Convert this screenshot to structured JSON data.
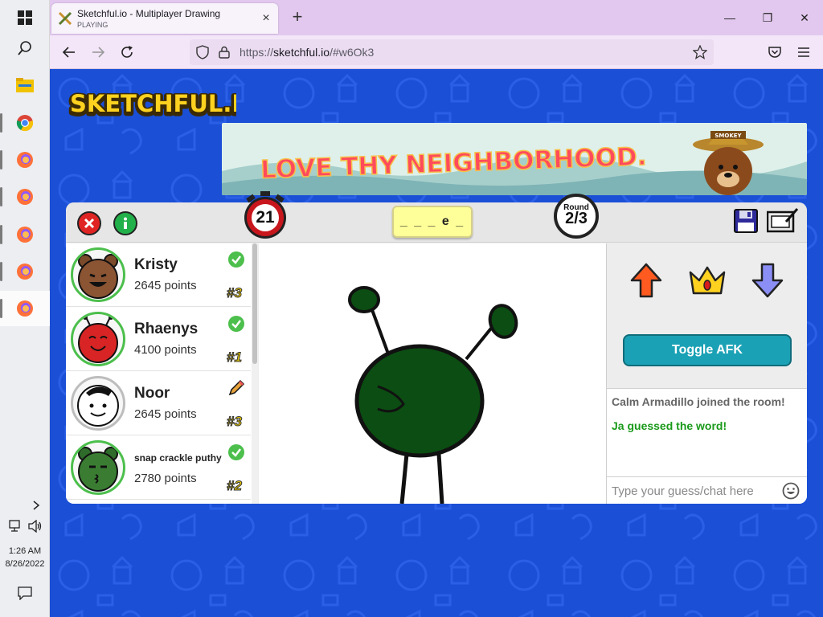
{
  "taskbar": {
    "clock_time": "1:26 AM",
    "clock_date": "8/26/2022"
  },
  "browser": {
    "tab_title": "Sketchful.io - Multiplayer Drawing",
    "tab_subtitle": "PLAYING",
    "tab_close": "×",
    "new_tab": "+",
    "minimize": "—",
    "maximize": "❐",
    "close": "✕",
    "url_prefix": "https://",
    "url_host": "sketchful.io",
    "url_path": "/#w6Ok3"
  },
  "game": {
    "logo_text": "SKETCHFUL.IO",
    "ad_headline": "LOVE THY NEIGHBORHOOD.",
    "ad_badge": "SMOKEY",
    "timer": "21",
    "word_hint": "_ _ _ e _",
    "round_label": "Round",
    "round_value": "2/3",
    "players": [
      {
        "name": "Kristy",
        "points": "2645 points",
        "rank": "#3",
        "status": "guessed"
      },
      {
        "name": "Rhaenys",
        "points": "4100 points",
        "rank": "#1",
        "status": "guessed"
      },
      {
        "name": "Noor",
        "points": "2645 points",
        "rank": "#3",
        "status": "drawing"
      },
      {
        "name": "snap crackle puthy",
        "points": "2780 points",
        "rank": "#2",
        "status": "guessed"
      }
    ],
    "afk_label": "Toggle AFK",
    "chat": [
      {
        "text": "Calm Armadillo joined the room!",
        "color": "#666666"
      },
      {
        "text": "Ja guessed the word!",
        "color": "#1a9a1a"
      }
    ],
    "chat_placeholder": "Type your guess/chat here"
  },
  "colors": {
    "page_bg": "#1a4fd6",
    "guessed": "#4cbf4c",
    "afk_button": "#1ba1b5",
    "drawing_green": "#0b4d12"
  }
}
